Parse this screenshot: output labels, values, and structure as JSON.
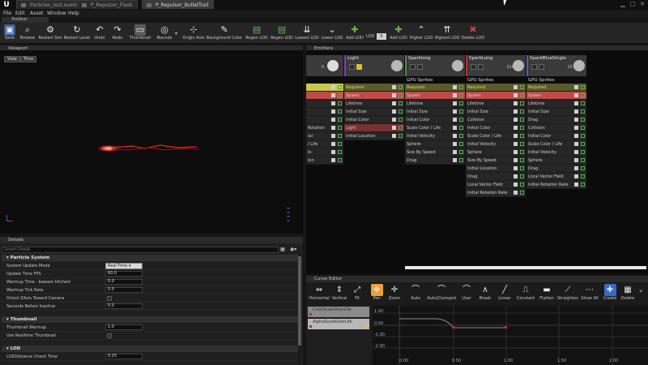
{
  "titlebar": {
    "tabs": [
      "Particles_test.evels",
      "P_Repulsor_Flash",
      "P_Repulsor_BulletTrail"
    ],
    "window_controls": [
      "minimize-icon",
      "maximize-icon",
      "close-icon"
    ]
  },
  "menu": [
    "File",
    "Edit",
    "Asset",
    "Window",
    "Help"
  ],
  "toolbar": {
    "tab_label": "Toolbar",
    "buttons": [
      "Save",
      "Browse",
      "Restart Sim",
      "Restart Level",
      "Undo",
      "Redo",
      "Thumbnail",
      "Bounds",
      "Origin Axis",
      "Background Color",
      "Regen LOD",
      "Regen LOD",
      "Lowest LOD",
      "Lower LOD",
      "Add LOD",
      "Add LOD",
      "Higher LOD",
      "Highest LOD",
      "Delete LOD"
    ],
    "lod_label": "LOD",
    "lod_value": "0"
  },
  "viewport": {
    "tab_label": "Viewport",
    "view_btn": "View",
    "time_btn": "Time"
  },
  "details": {
    "tab_label": "Details",
    "search_placeholder": "Search Details",
    "categories": [
      "Particle System",
      "Thumbnail",
      "LOD"
    ],
    "particle_system": [
      {
        "label": "System Update Mode",
        "value": "Real-Time"
      },
      {
        "label": "Update Time FPS",
        "value": "60.0"
      },
      {
        "label": "Warmup Time - beware hitches!",
        "value": "0.0"
      },
      {
        "label": "Warmup Tick Rate",
        "value": "0.0"
      },
      {
        "label": "Orient ZAxis Toward Camera",
        "value": ""
      },
      {
        "label": "Seconds Before Inactive",
        "value": "0.0"
      }
    ],
    "thumbnail": [
      {
        "label": "Thumbnail Warmup",
        "value": "1.0"
      },
      {
        "label": "Use Realtime Thumbnail",
        "value": ""
      }
    ],
    "lod": [
      {
        "label": "LODDistance Check Time",
        "value": "0.25"
      }
    ]
  },
  "emitters": {
    "tab_label": "Emitters",
    "columns": [
      {
        "name": "",
        "count": "0",
        "type": "",
        "modules": [
          "Required",
          "Spawn",
          "",
          "",
          "",
          "Rotation",
          "",
          "ial",
          "/ Life",
          "le",
          "ion"
        ]
      },
      {
        "name": "Light",
        "count": "3",
        "type": "",
        "modules": [
          "Required",
          "Spawn",
          "Lifetime",
          "Initial Size",
          "Initial Color",
          "Light",
          "Initial Location"
        ]
      },
      {
        "name": "Sparklong",
        "count": "7",
        "type": "GPU Sprites",
        "modules": [
          "Required",
          "Spawn",
          "Lifetime",
          "Initial Size",
          "Initial Color",
          "Scale Color / Life",
          "Initial Velocity",
          "Sphere",
          "Size By Speed",
          "Drag"
        ]
      },
      {
        "name": "SparkLong",
        "count": "216",
        "type": "GPU Sprites",
        "modules": [
          "Required",
          "Spawn",
          "Lifetime",
          "Initial Size",
          "Collision",
          "Initial Color",
          "Scale Color / Life",
          "Initial Velocity",
          "Sphere",
          "Size By Speed",
          "Initial Location",
          "Drag",
          "Local Vector Field",
          "Initial Rotation Rate"
        ]
      },
      {
        "name": "SparkBlueSingle",
        "count": "157",
        "type": "GPU Sprites",
        "modules": [
          "Required",
          "Spawn",
          "Lifetime",
          "Initial Size",
          "Drag",
          "Collision",
          "Initial Color",
          "Scale Color / Life",
          "Initial Velocity",
          "Sphere",
          "Drag",
          "Local Vector Field",
          "Initial Rotation Rate"
        ]
      }
    ]
  },
  "curve_editor": {
    "tab_label": "Curve Editor",
    "buttons": [
      "Horizontal",
      "Vertical",
      "Fit",
      "Pan",
      "Zoom",
      "Auto",
      "Auto/Clamped",
      "User",
      "Break",
      "Linear",
      "Constant",
      "Flatten",
      "Straighten",
      "Show All",
      "Create",
      "Delete"
    ],
    "curves": [
      "ColorScaleOverLife",
      "AlphaScaleOverLife"
    ],
    "y_ticks": [
      "1.00",
      "0.00",
      "-1.00",
      "-2.00"
    ],
    "x_ticks": [
      "0.00",
      "0.50",
      "1.00",
      "1.50",
      "2.00"
    ]
  },
  "colors": {
    "required": "#c8c84a",
    "spawn": "#c04a4a",
    "accent": "#f0a030",
    "light_module": "#7a3030"
  }
}
